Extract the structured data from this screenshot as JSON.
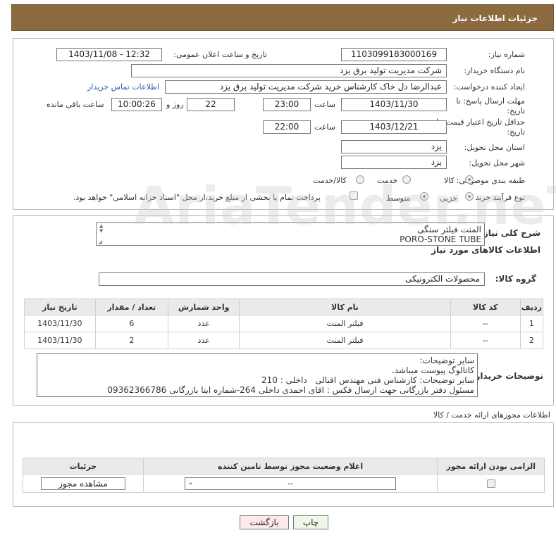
{
  "header": {
    "title": "جزئیات اطلاعات نیاز"
  },
  "form": {
    "need_number_label": "شماره نیاز:",
    "need_number": "1103099183000169",
    "announce_label": "تاریخ و ساعت اعلان عمومی:",
    "announce_value": "1403/11/08 - 12:32",
    "buyer_org_label": "نام دستگاه خریدار:",
    "buyer_org": "شرکت مدیریت تولید برق یزد",
    "creator_label": "ایجاد کننده درخواست:",
    "creator": "عبدالرضا دل خاک کارشناس خرید شرکت مدیریت تولید برق یزد",
    "contact_link": "اطلاعات تماس خریدار",
    "reply_deadline_label_1": "مهلت ارسال پاسخ: تا",
    "reply_deadline_label_2": "تاریخ:",
    "reply_date": "1403/11/30",
    "time_label": "ساعت",
    "reply_time": "23:00",
    "days_value": "22",
    "days_label": "روز و",
    "remaining_time": "10:00:26",
    "remaining_label": "ساعت باقی مانده",
    "price_validity_label_1": "حداقل تاریخ اعتبار قیمت: تا",
    "price_validity_label_2": "تاریخ:",
    "price_date": "1403/12/21",
    "price_time": "22:00",
    "province_label": "استان محل تحویل:",
    "province": "یزد",
    "city_label": "شهر محل تحویل:",
    "city": "یزد",
    "category_label": "طبقه بندی موضوعی:",
    "category_options": [
      "کالا",
      "خدمت",
      "کالا/خدمت"
    ],
    "process_label": "نوع فرآیند خرید :",
    "process_options": [
      "جزیی",
      "متوسط"
    ],
    "treasury_note": "پرداخت تمام یا بخشی از مبلغ خرید،از محل \"اسناد خزانه اسلامی\" خواهد بود."
  },
  "items_section": {
    "summary_label": "شرح کلی نیاز:",
    "summary_line1": "المنت فیلتر سنگی",
    "summary_line2": "PORO-STONE TUBE",
    "goods_info_title": "اطلاعات کالاهای مورد نیاز",
    "goods_group_label": "گروه کالا:",
    "goods_group": "محصولات الکترونیکی",
    "columns": [
      "ردیف",
      "کد کالا",
      "نام کالا",
      "واحد شمارش",
      "تعداد / مقدار",
      "تاریخ نیاز"
    ],
    "rows": [
      [
        "1",
        "--",
        "فیلتر المنت",
        "عدد",
        "6",
        "1403/11/30"
      ],
      [
        "2",
        "--",
        "فیلتر المنت",
        "عدد",
        "2",
        "1403/11/30"
      ]
    ],
    "buyer_notes_label": "توضیحات خریدار:",
    "notes": [
      "سایر توضیحات:",
      "کاتالوگ پیوست میباشد.",
      "سایر توضیحات: کارشناس فنی مهندس اقبالی   داخلی : 210",
      "مسئول دفتر بازرگانی جهت ارسال فکس : اقای احمدی داخلی 264-شماره ایتا بازرگانی 09362366786"
    ]
  },
  "permits": {
    "title": "اطلاعات مجوزهای ارائه خدمت / کالا",
    "columns": [
      "الزامی بودن ارائه مجوز",
      "اعلام وضعیت مجوز توسط تامین کننده",
      "جزئیات"
    ],
    "select_value": "--",
    "view_button": "مشاهده مجوز"
  },
  "footer": {
    "print_button": "چاپ",
    "back_button": "بازگشت"
  },
  "watermark": "AriaTender.neT"
}
